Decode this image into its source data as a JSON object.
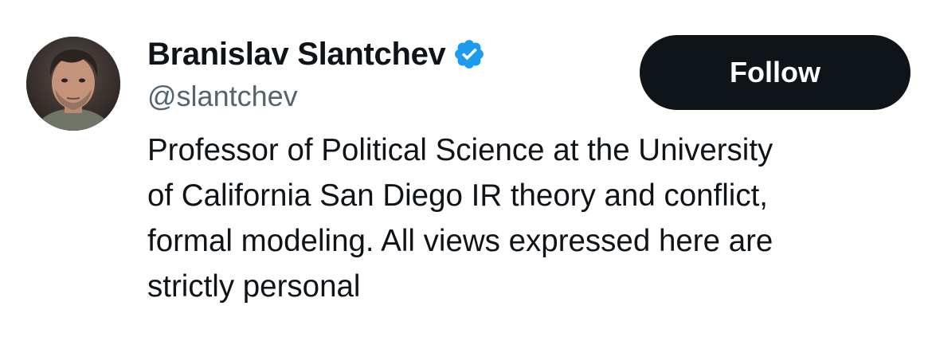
{
  "profile": {
    "display_name": "Branislav Slantchev",
    "handle": "@slantchev",
    "verified_icon": "verified-badge-icon",
    "verified_color": "#1d9bf0",
    "bio_lines": [
      "Professor of Political Science at the University",
      "of California San Diego IR theory and conflict,",
      "formal modeling. All views expressed here are",
      "strictly personal"
    ]
  },
  "actions": {
    "follow_label": "Follow"
  },
  "colors": {
    "text": "#0f1419",
    "secondary_text": "#536471",
    "button_bg": "#0f1419",
    "button_text": "#ffffff"
  }
}
